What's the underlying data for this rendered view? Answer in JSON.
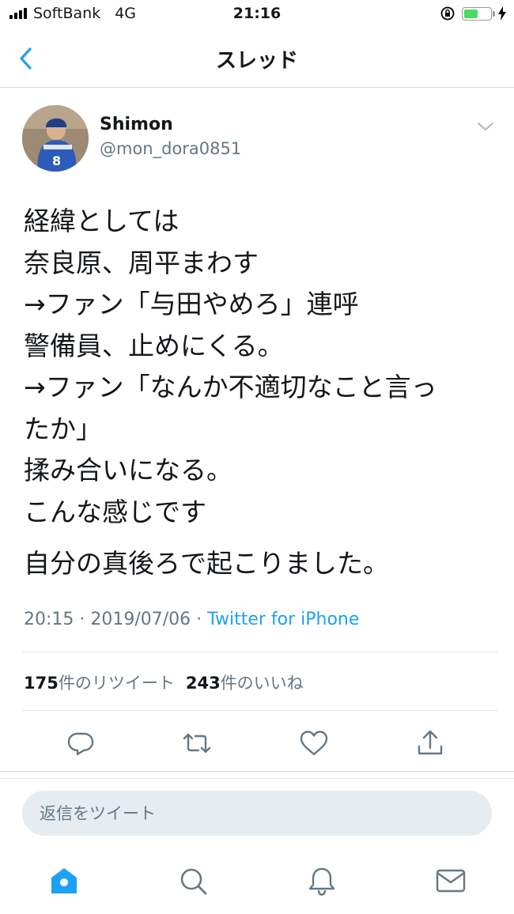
{
  "status_bar": {
    "carrier": "SoftBank",
    "network": "4G",
    "time": "21:16",
    "battery_level": 0.55,
    "battery_color": "#4cd964"
  },
  "nav": {
    "title": "スレッド",
    "back_icon": "chevron-left-icon"
  },
  "tweet": {
    "author_name": "Shimon",
    "author_handle": "@mon_dora0851",
    "text_lines": [
      "経緯としては",
      "奈良原、周平まわす",
      "→ファン「与田やめろ」連呼",
      "警備員、止めにくる。",
      "→ファン「なんか不適切なこと言っ",
      "たか」",
      "揉み合いになる。",
      "こんな感じです"
    ],
    "text_line_2": "自分の真後ろで起こりました。",
    "timestamp": "20:15 · 2019/07/06",
    "separator": " · ",
    "source": "Twitter for iPhone"
  },
  "stats": {
    "retweets_count": "175",
    "retweets_label": "件のリツイート",
    "likes_count": "243",
    "likes_label": "件のいいね"
  },
  "actions": [
    "reply-icon",
    "retweet-icon",
    "like-icon",
    "share-icon"
  ],
  "reply": {
    "placeholder": "返信をツイート"
  },
  "tabbar": [
    "home-icon",
    "search-icon",
    "notifications-icon",
    "messages-icon"
  ],
  "colors": {
    "accent": "#1da1f2",
    "secondary_text": "#657786",
    "icon_gray": "#657786"
  }
}
